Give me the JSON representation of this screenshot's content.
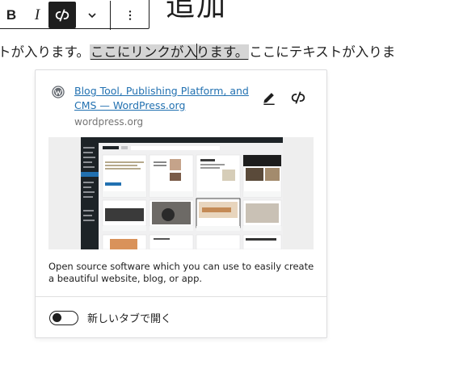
{
  "toolbar": {
    "bold_label": "B",
    "italic_label": "I"
  },
  "heading": {
    "text": "追加"
  },
  "paragraph": {
    "before": "トが入ります。",
    "linked": "ここにリンクが入ります。",
    "linked_before_caret": "ここにリンクが入",
    "linked_after_caret": "ります。",
    "after": "ここにテキストが入りま"
  },
  "link_popover": {
    "title": "Blog Tool, Publishing Platform, and CMS — WordPress.org",
    "domain": "wordpress.org",
    "description": "Open source software which you can use to easily create a beautiful website, blog, or app.",
    "new_tab_label": "新しいタブで開く",
    "new_tab_enabled": false
  },
  "icons": {
    "bold": "bold-icon",
    "italic": "italic-icon",
    "unlink": "unlink-icon",
    "more": "chevron-down-icon",
    "options": "more-vertical-icon",
    "favicon": "wordpress-logo-icon",
    "edit": "pencil-icon"
  },
  "colors": {
    "link": "#2271b1",
    "accent": "#1e1e1e",
    "selection": "#d5d5d5"
  }
}
